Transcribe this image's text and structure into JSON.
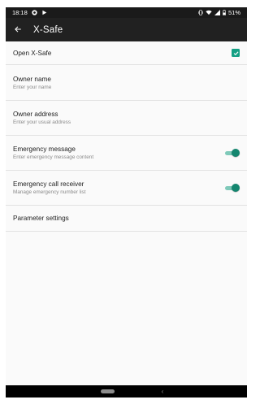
{
  "status_bar": {
    "time": "18:18",
    "battery": "51%"
  },
  "app_bar": {
    "title": "X-Safe"
  },
  "settings": [
    {
      "title": "Open X-Safe",
      "subtitle": "",
      "control": "checkbox",
      "checked": true
    },
    {
      "title": "Owner name",
      "subtitle": "Enter your name",
      "control": "none"
    },
    {
      "title": "Owner address",
      "subtitle": "Enter your usual address",
      "control": "none"
    },
    {
      "title": "Emergency message",
      "subtitle": "Enter emergency message content",
      "control": "switch",
      "checked": true
    },
    {
      "title": "Emergency call receiver",
      "subtitle": "Manage emergency number list",
      "control": "switch",
      "checked": true
    },
    {
      "title": "Parameter settings",
      "subtitle": "",
      "control": "none"
    }
  ],
  "colors": {
    "accent": "#14a084",
    "switch_thumb": "#14866f",
    "switch_track": "#7fc9b9",
    "app_bar": "#212121",
    "status_bar": "#1a1a1a"
  }
}
